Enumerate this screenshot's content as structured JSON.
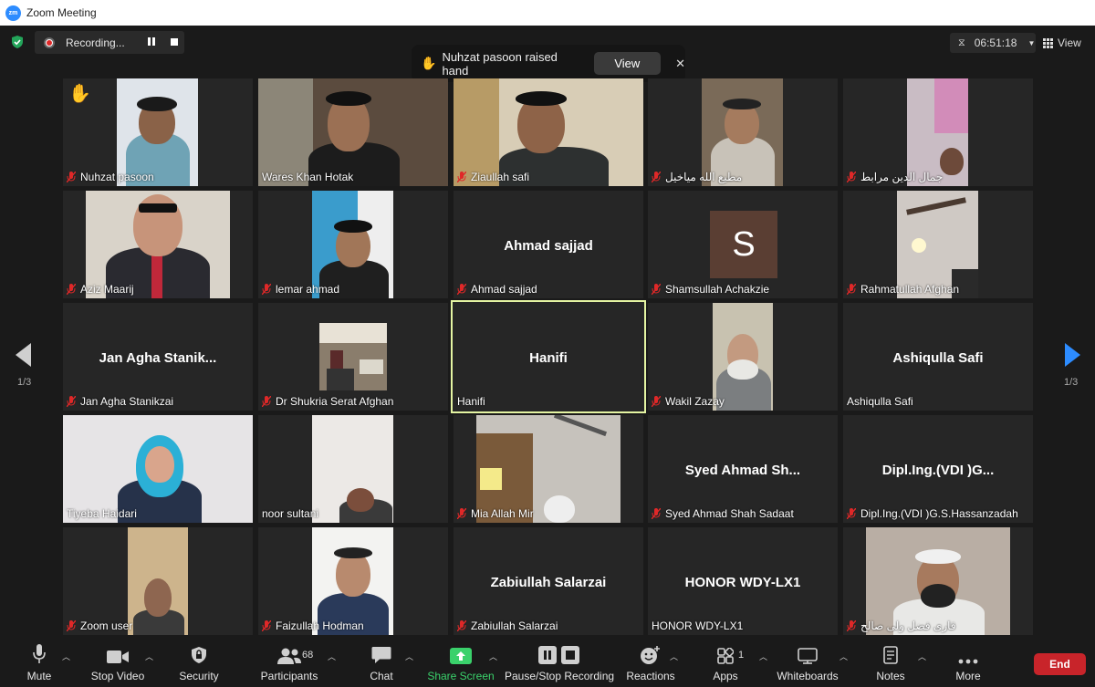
{
  "window": {
    "title": "Zoom Meeting",
    "logo_text": "zm"
  },
  "recording": {
    "label": "Recording..."
  },
  "notification": {
    "text": "Nuhzat pasoon raised hand",
    "button": "View"
  },
  "timer": {
    "value": "06:51:18"
  },
  "view_button": {
    "label": "View"
  },
  "pages": {
    "left": "1/3",
    "right": "1/3"
  },
  "participants": [
    {
      "name": "Nuhzat pasoon",
      "muted": true,
      "raised_hand": true
    },
    {
      "name": "Wares Khan Hotak",
      "muted": false
    },
    {
      "name": "Ziaullah safi",
      "muted": true
    },
    {
      "name": "مطیع الله میاخیل",
      "muted": true
    },
    {
      "name": "جمال الدين مرابط",
      "muted": true
    },
    {
      "name": "Aziz Maarij",
      "muted": true
    },
    {
      "name": "lemar ahmad",
      "muted": true
    },
    {
      "name": "Ahmad sajjad",
      "muted": true,
      "display": "Ahmad sajjad"
    },
    {
      "name": "Shamsullah Achakzie",
      "muted": true,
      "avatar": "S"
    },
    {
      "name": "Rahmatullah Afghan",
      "muted": true
    },
    {
      "name": "Jan Agha Stanikzai",
      "muted": true,
      "display": "Jan Agha Stanik..."
    },
    {
      "name": "Dr Shukria Serat Afghan",
      "muted": true
    },
    {
      "name": "Hanifi",
      "muted": false,
      "display": "Hanifi",
      "active_speaker": true
    },
    {
      "name": "Wakil Zazay",
      "muted": true
    },
    {
      "name": "Ashiqulla Safi",
      "muted": false,
      "display": "Ashiqulla Safi"
    },
    {
      "name": "Tiyeba Haidari",
      "muted": false
    },
    {
      "name": "noor sultani",
      "muted": false
    },
    {
      "name": "Mia Allah Mir",
      "muted": true
    },
    {
      "name": "Syed Ahmad Shah Sadaat",
      "muted": true,
      "display": "Syed Ahmad Sh..."
    },
    {
      "name": "Dipl.Ing.(VDI )G.S.Hassanzadah",
      "muted": true,
      "display": "Dipl.Ing.(VDI )G..."
    },
    {
      "name": "Zoom user",
      "muted": true
    },
    {
      "name": "Faizullah Hodman",
      "muted": true
    },
    {
      "name": "Zabiullah Salarzai",
      "muted": true,
      "display": "Zabiullah Salarzai"
    },
    {
      "name": "HONOR WDY-LX1",
      "muted": false,
      "display": "HONOR WDY-LX1"
    },
    {
      "name": "قاری فضل ولی صالح",
      "muted": true
    }
  ],
  "toolbar": {
    "mute": "Mute",
    "stop_video": "Stop Video",
    "security": "Security",
    "participants": "Participants",
    "participants_count": "68",
    "chat": "Chat",
    "share_screen": "Share Screen",
    "pause_recording": "Pause/Stop Recording",
    "reactions": "Reactions",
    "apps": "Apps",
    "apps_count": "1",
    "whiteboards": "Whiteboards",
    "notes": "Notes",
    "more": "More",
    "end": "End"
  },
  "colors": {
    "accent": "#2d8cff",
    "share_green": "#3ad16b",
    "end_red": "#c8242a",
    "active_border": "#e4f4a2",
    "muted_red": "#e02828"
  }
}
